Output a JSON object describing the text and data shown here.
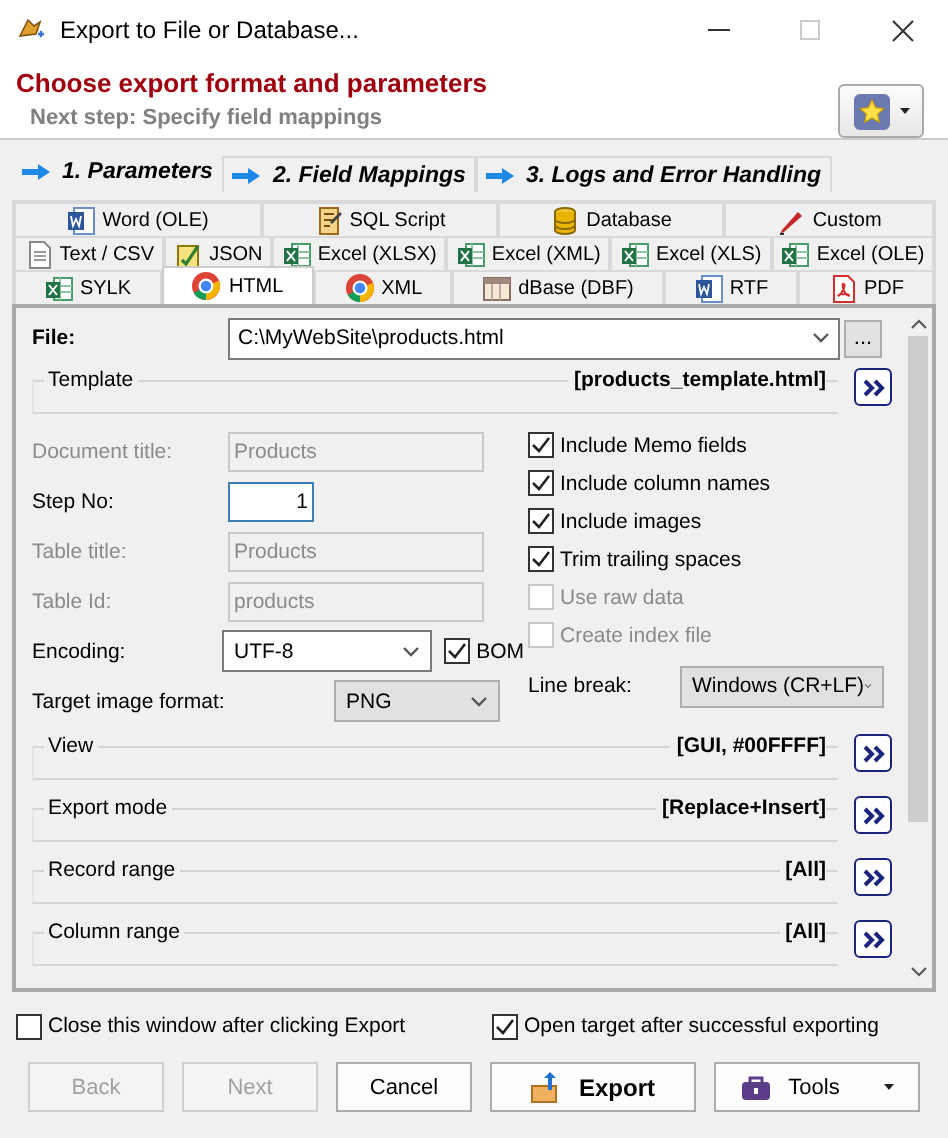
{
  "window": {
    "title": "Export to File or Database..."
  },
  "header": {
    "title": "Choose export format and parameters",
    "subtitle": "Next step: Specify field mappings"
  },
  "step_tabs": [
    {
      "label": "1. Parameters",
      "selected": true
    },
    {
      "label": "2. Field Mappings",
      "selected": false
    },
    {
      "label": "3. Logs and Error Handling",
      "selected": false
    }
  ],
  "format_tabs": [
    [
      {
        "label": "Word (OLE)",
        "kind": "word",
        "selected": false
      },
      {
        "label": "SQL Script",
        "kind": "script",
        "selected": false
      },
      {
        "label": "Database",
        "kind": "database",
        "selected": false
      },
      {
        "label": "Custom",
        "kind": "pen",
        "selected": false
      }
    ],
    [
      {
        "label": "Text / CSV",
        "kind": "text",
        "selected": false
      },
      {
        "label": "JSON",
        "kind": "json",
        "selected": false
      },
      {
        "label": "Excel (XLSX)",
        "kind": "excel",
        "selected": false
      },
      {
        "label": "Excel (XML)",
        "kind": "excel",
        "selected": false
      },
      {
        "label": "Excel (XLS)",
        "kind": "excel",
        "selected": false
      },
      {
        "label": "Excel (OLE)",
        "kind": "excel",
        "selected": false
      }
    ],
    [
      {
        "label": "SYLK",
        "kind": "excel",
        "selected": false
      },
      {
        "label": "HTML",
        "kind": "browser",
        "selected": true
      },
      {
        "label": "XML",
        "kind": "browser",
        "selected": false
      },
      {
        "label": "dBase (DBF)",
        "kind": "table",
        "selected": false
      },
      {
        "label": "RTF",
        "kind": "word",
        "selected": false
      },
      {
        "label": "PDF",
        "kind": "pdf",
        "selected": false
      }
    ]
  ],
  "file": {
    "label": "File:",
    "value": "C:\\MyWebSite\\products.html",
    "browse": "..."
  },
  "template": {
    "label": "Template",
    "value": "[products_template.html]"
  },
  "left_fields": [
    {
      "label": "Document title:",
      "value": "Products",
      "kind": "text",
      "disabled": true
    },
    {
      "label": "Step No:",
      "value": "1",
      "kind": "number",
      "disabled": false
    },
    {
      "label": "Table title:",
      "value": "Products",
      "kind": "text",
      "disabled": true
    },
    {
      "label": "Table Id:",
      "value": "products",
      "kind": "text",
      "disabled": true
    }
  ],
  "encoding": {
    "label": "Encoding:",
    "value": "UTF-8",
    "bom": {
      "label": "BOM",
      "checked": true
    }
  },
  "image_format": {
    "label": "Target image format:",
    "value": "PNG"
  },
  "options": [
    {
      "label": "Include Memo fields",
      "checked": true,
      "disabled": false
    },
    {
      "label": "Include column names",
      "checked": true,
      "disabled": false
    },
    {
      "label": "Include images",
      "checked": true,
      "disabled": false
    },
    {
      "label": "Trim trailing spaces",
      "checked": true,
      "disabled": false
    },
    {
      "label": "Use raw data",
      "checked": false,
      "disabled": true
    },
    {
      "label": "Create index file",
      "checked": false,
      "disabled": true
    }
  ],
  "line_break": {
    "label": "Line break:",
    "value": "Windows (CR+LF)"
  },
  "sections": [
    {
      "label": "View",
      "value": "[GUI, #00FFFF]"
    },
    {
      "label": "Export mode",
      "value": "[Replace+Insert]"
    },
    {
      "label": "Record range",
      "value": "[All]"
    },
    {
      "label": "Column range",
      "value": "[All]"
    }
  ],
  "bottom_checks": [
    {
      "label": "Close this window after clicking Export",
      "checked": false
    },
    {
      "label": "Open target after successful exporting",
      "checked": true
    }
  ],
  "buttons": [
    {
      "label": "Back",
      "kind": "plain",
      "disabled": true
    },
    {
      "label": "Next",
      "kind": "plain",
      "disabled": true
    },
    {
      "label": "Cancel",
      "kind": "plain",
      "disabled": false
    },
    {
      "label": "Export",
      "kind": "export",
      "disabled": false
    },
    {
      "label": "Tools",
      "kind": "menu",
      "disabled": false
    }
  ]
}
